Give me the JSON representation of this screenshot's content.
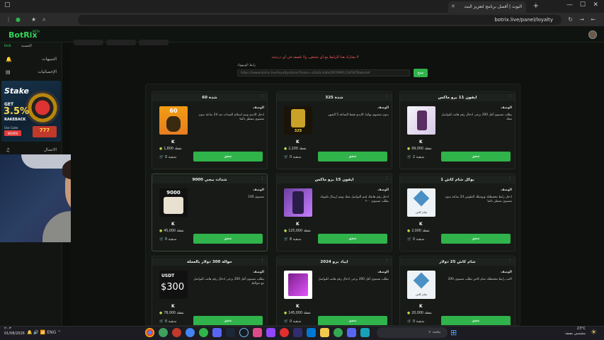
{
  "browser": {
    "tab_title": "البوت | أفضل برنامج لتعزيز البث",
    "url": "botrix.live/panel/loyalty"
  },
  "app": {
    "logo": "BotRix",
    "logo_badge": "BETA",
    "account_label": "الحسبة",
    "account_status": "kick"
  },
  "sidebar": {
    "items": [
      {
        "label": "التنبيهات",
        "icon": "bell-icon"
      },
      {
        "label": "الإحصائيات",
        "icon": "chart-icon"
      },
      {
        "label": "الاتصال",
        "icon": "music-icon"
      }
    ]
  },
  "ad": {
    "brand": "Stake",
    "get": "GET",
    "percent": "3.5%",
    "rakeback": "RAKEBACK",
    "code_label": "Use Code:",
    "code_value": "NOOR0",
    "slot": "777"
  },
  "loyalty": {
    "warning": "لا تشارك هذا الرابط مع أي شخص، ولا تلصقه في أي دردشة",
    "ref_label": "رابط الويبهوك",
    "ref_value": "https://www.botrix.live/loyalty/store/?token=a1b2c3d4e5f6789012345678abcdef",
    "copy_label": "نسخ"
  },
  "cards": [
    {
      "title": "ايفون 11 برو ماكس",
      "desc_header": "الوصف",
      "desc": "يطلب مستوى أقل 200 يرجى ادخال رقم هاتف للتواصل معك",
      "price": "99,000",
      "price_label": "نقطة",
      "qty": "2",
      "qty_label": "متبقية",
      "buy": "تحقق",
      "image": "phone"
    },
    {
      "title": "شدة 325",
      "desc_header": "الوصف",
      "desc": "بدون مستوى نهائيا، الايدي فقط الساعة 5 الشهر",
      "price": "2,200",
      "price_label": "نقطة",
      "qty": "0",
      "qty_label": "متبقية",
      "buy": "تحقق",
      "image": "uc325"
    },
    {
      "title": "شدة 60",
      "desc_header": "الوصف",
      "desc": "ادخل الايدي ويتم استلام الشدات بعد 24 ساعة بدون مستوى منتظر دائما",
      "price": "1,800",
      "price_label": "نقطة",
      "qty": "0",
      "qty_label": "متبقية",
      "buy": "تحقق",
      "image": "uc60"
    },
    {
      "title": "بوكل شام كاش 1",
      "desc_header": "الوصف",
      "desc": "ادخل رابط محفظتك وبوصلك الفلوس 24 ساعة بدون مستوى منتظر دائما",
      "price": "2,000",
      "price_label": "نقطة",
      "qty": "0",
      "qty_label": "متبقية",
      "buy": "تحقق",
      "image": "shamcash"
    },
    {
      "title": "ايفون 15 برو ماكس",
      "desc_header": "الوصف",
      "desc": "ادخل رقم هاتفك ليتم التواصل معك ويتم ارسال تلفونك بطلب مستوى ٢٠٠",
      "price": "125,000",
      "price_label": "نقطة",
      "qty": "8",
      "qty_label": "متبقية",
      "buy": "تحقق",
      "image": "iphone15"
    },
    {
      "title": "شدات ببجي 9000",
      "desc_header": "الوصف",
      "desc": "مستوى 160",
      "price": "45,000",
      "price_label": "نقطة",
      "qty": "0",
      "qty_label": "متبقية",
      "buy": "تحقق",
      "image": "uc9000"
    },
    {
      "title": "شام كاش 25 دولار",
      "desc_header": "الوصف",
      "desc": "اكتب رابط محفظتك شام كاش تطلب مستوى 200",
      "price": "20,000",
      "price_label": "نقطة",
      "qty": "0",
      "qty_label": "متبقية",
      "buy": "تحقق",
      "image": "shamcash"
    },
    {
      "title": "ايباد برو 2024",
      "desc_header": "الوصف",
      "desc": "يطلب مستوى أقل 200 يرجى ادخال رقم هاتف للتواصل",
      "price": "145,000",
      "price_label": "نقطة",
      "qty": "0",
      "qty_label": "متبقية",
      "buy": "تحقق",
      "image": "ipad"
    },
    {
      "title": "حوالة 300 دولار بالعملة",
      "desc_header": "الوصف",
      "desc": "يطلب مستوى أقل 200 يرجى ادخال رقم هاتف للتواصل مع حوالتك",
      "price": "78,000",
      "price_label": "نقطة",
      "qty": "0",
      "qty_label": "متبقية",
      "buy": "تحقق",
      "image": "usdt"
    }
  ],
  "images": {
    "uc60": "60",
    "uc325": "325",
    "uc9000": "9000",
    "usdt_label": "USDT",
    "usdt_value": "$300",
    "shamcash_label": "شام كاش"
  },
  "taskbar": {
    "time": "٢:٠٣",
    "date": "01/08/2026",
    "lang": "ENG",
    "search": "بحث",
    "temp": "23°C",
    "weather": "مشمس بصفة"
  },
  "colors": {
    "accent": "#2fb34a",
    "logo": "#34d45a",
    "warning": "#ff5a5a"
  }
}
